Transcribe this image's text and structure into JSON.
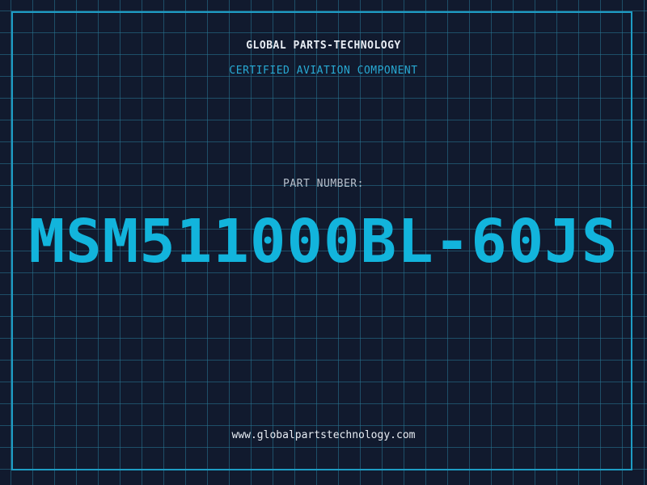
{
  "header": {
    "company": "GLOBAL PARTS-TECHNOLOGY",
    "tagline": "CERTIFIED AVIATION COMPONENT"
  },
  "part": {
    "label": "PART NUMBER:",
    "number": "MSM511000BL-60JS"
  },
  "footer": {
    "website": "www.globalpartstechnology.com"
  },
  "colors": {
    "background": "#111a2e",
    "grid": "#28788f",
    "accent": "#12b4dc",
    "frame": "#1e9cc4"
  }
}
